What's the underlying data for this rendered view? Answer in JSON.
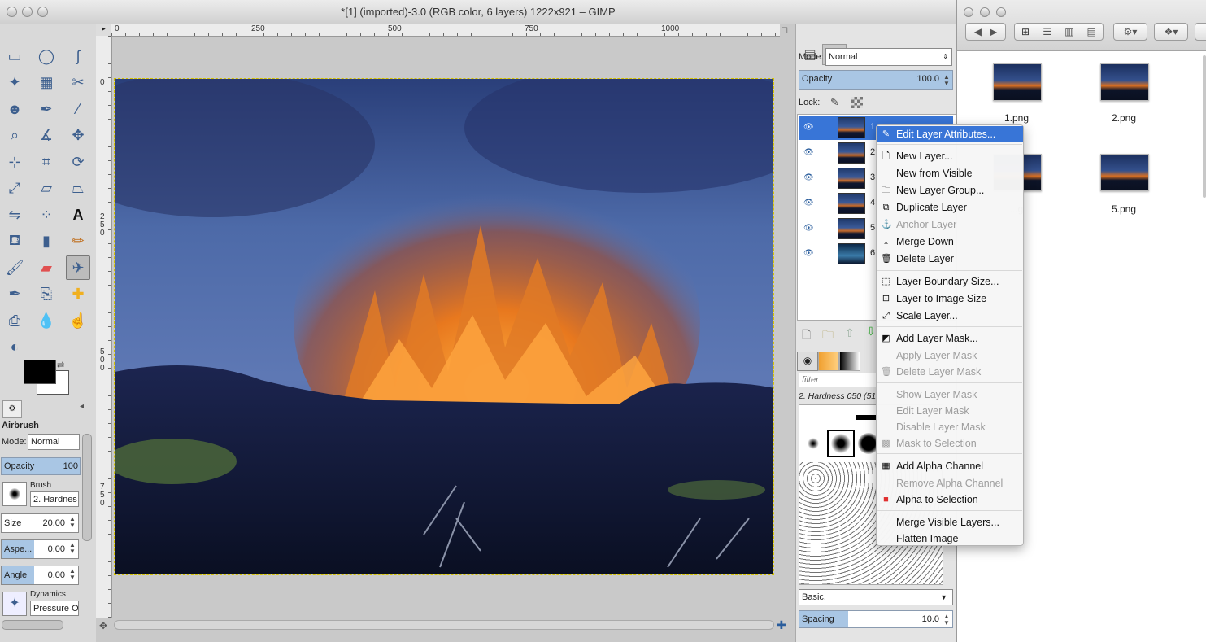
{
  "window": {
    "title": "*[1] (imported)-3.0 (RGB color, 6 layers) 1222x921 – GIMP"
  },
  "ruler": {
    "h_labels": [
      "0",
      "250",
      "500",
      "750",
      "1000"
    ],
    "v_labels": [
      "0",
      "2\n5\n0",
      "5\n0\n0",
      "7\n5\n0"
    ]
  },
  "toolbox": {
    "tools": [
      "rect-select",
      "ellipse-select",
      "free-select",
      "fuzzy-select",
      "color-select",
      "scissors",
      "foreground-select",
      "paths",
      "color-picker",
      "zoom",
      "measure",
      "move",
      "align",
      "crop",
      "rotate",
      "scale",
      "shear",
      "perspective",
      "flip",
      "cage",
      "text",
      "bucket-fill",
      "blend",
      "pencil",
      "paintbrush",
      "eraser",
      "airbrush",
      "ink",
      "clone",
      "heal",
      "perspective-clone",
      "blur",
      "smudge",
      "dodge"
    ],
    "selected_tool": "airbrush"
  },
  "tool_options": {
    "title": "Airbrush",
    "mode_label": "Mode:",
    "mode_value": "Normal",
    "opacity_label": "Opacity",
    "opacity_value": "100",
    "brush_label": "Brush",
    "brush_value": "2. Hardnes",
    "size_label": "Size",
    "size_value": "20.00",
    "aspect_label": "Aspe...",
    "aspect_value": "0.00",
    "angle_label": "Angle",
    "angle_value": "0.00",
    "dynamics_label": "Dynamics",
    "dynamics_value": "Pressure O"
  },
  "layers": {
    "mode_label": "Mode:",
    "mode_value": "Normal",
    "opacity_label": "Opacity",
    "opacity_value": "100.0",
    "lock_label": "Lock:",
    "items": [
      {
        "name": "1."
      },
      {
        "name": "2."
      },
      {
        "name": "3."
      },
      {
        "name": "4."
      },
      {
        "name": "5."
      },
      {
        "name": "6."
      }
    ]
  },
  "brushes": {
    "filter_placeholder": "filter",
    "current": "2. Hardness 050 (51",
    "preset": "Basic,",
    "spacing_label": "Spacing",
    "spacing_value": "10.0"
  },
  "context_menu": {
    "items": [
      {
        "label": "Edit Layer Attributes...",
        "highlighted": true,
        "disabled": false,
        "icon": "edit-icon"
      },
      {
        "label": "New Layer...",
        "disabled": false,
        "icon": "new-layer-icon"
      },
      {
        "label": "New from Visible",
        "disabled": false,
        "icon": ""
      },
      {
        "label": "New Layer Group...",
        "disabled": false,
        "icon": "folder-icon"
      },
      {
        "label": "Duplicate Layer",
        "disabled": false,
        "icon": "duplicate-icon"
      },
      {
        "label": "Anchor Layer",
        "disabled": true,
        "icon": "anchor-icon"
      },
      {
        "label": "Merge Down",
        "disabled": false,
        "icon": "merge-down-icon"
      },
      {
        "label": "Delete Layer",
        "disabled": false,
        "icon": "trash-icon"
      },
      {
        "label": "Layer Boundary Size...",
        "disabled": false,
        "icon": "boundary-icon"
      },
      {
        "label": "Layer to Image Size",
        "disabled": false,
        "icon": "fit-icon"
      },
      {
        "label": "Scale Layer...",
        "disabled": false,
        "icon": "scale-icon"
      },
      {
        "label": "Add Layer Mask...",
        "disabled": false,
        "icon": "mask-icon"
      },
      {
        "label": "Apply Layer Mask",
        "disabled": true,
        "icon": ""
      },
      {
        "label": "Delete Layer Mask",
        "disabled": true,
        "icon": "trash-icon"
      },
      {
        "label": "Show Layer Mask",
        "disabled": true,
        "icon": ""
      },
      {
        "label": "Edit Layer Mask",
        "disabled": true,
        "icon": ""
      },
      {
        "label": "Disable Layer Mask",
        "disabled": true,
        "icon": ""
      },
      {
        "label": "Mask to Selection",
        "disabled": true,
        "icon": "mask-selection-icon"
      },
      {
        "label": "Add Alpha Channel",
        "disabled": false,
        "icon": "alpha-icon"
      },
      {
        "label": "Remove Alpha Channel",
        "disabled": true,
        "icon": ""
      },
      {
        "label": "Alpha to Selection",
        "disabled": false,
        "icon": "alpha-selection-icon"
      },
      {
        "label": "Merge Visible Layers...",
        "disabled": false,
        "icon": ""
      },
      {
        "label": "Flatten Image",
        "disabled": false,
        "icon": ""
      }
    ]
  },
  "finder": {
    "files": [
      {
        "name": "1.png"
      },
      {
        "name": "2.png"
      },
      {
        "name": "...g"
      },
      {
        "name": "5.png"
      }
    ]
  },
  "colors": {
    "highlight": "#3875d7",
    "fg": "#000000",
    "bg": "#ffffff"
  }
}
